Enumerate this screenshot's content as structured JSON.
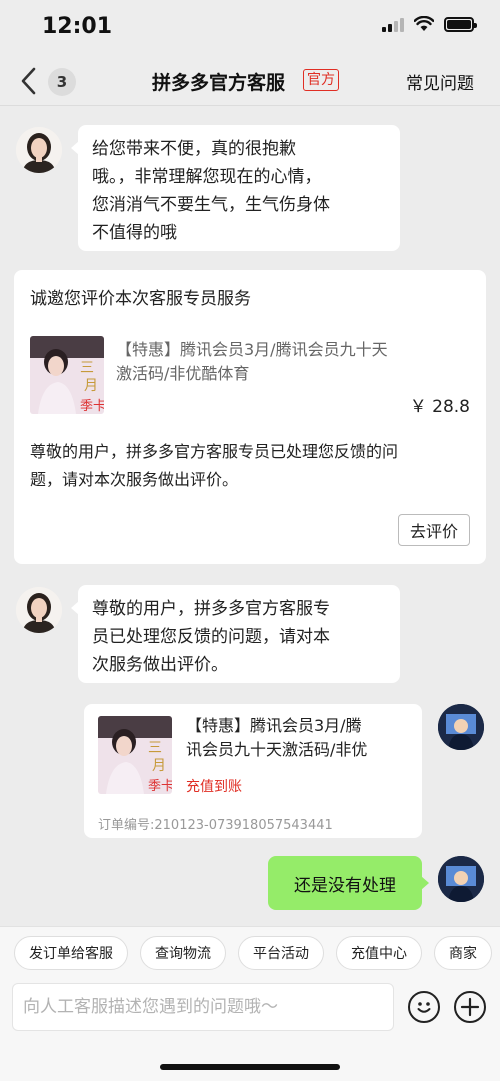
{
  "status_bar": {
    "time": "12:01"
  },
  "nav": {
    "back_icon": "chevron-left-icon",
    "unread_count": "3",
    "title": "拼多多官方客服",
    "official_tag": "官方",
    "faq_link": "常见问题"
  },
  "messages": {
    "agent_1": {
      "lines": [
        "给您带来不便，真的很抱歉",
        "哦。，非常理解您现在的心情，",
        "您消消气不要生气，生气伤身体",
        "不值得的哦"
      ]
    },
    "evaluation_card": {
      "title": "诚邀您评价本次客服专员服务",
      "product_title_lines": [
        "【特惠】腾讯会员3月/腾讯会员九十天",
        "激活码/非优酷体育"
      ],
      "price": "￥ 28.8",
      "body_lines": [
        "尊敬的用户，拼多多官方客服专员已处理您反馈的问",
        "题，请对本次服务做出评价。"
      ],
      "button": "去评价"
    },
    "agent_2": {
      "lines": [
        "尊敬的用户，拼多多官方客服专",
        "员已处理您反馈的问题，请对本",
        "次服务做出评价。"
      ]
    },
    "order_card": {
      "title_lines": [
        "【特惠】腾讯会员3月/腾",
        "讯会员九十天激活码/非优"
      ],
      "status": "充值到账",
      "order_no": "订单编号:210123-073918057543441"
    },
    "user_msg": "还是没有处理"
  },
  "quick_replies": [
    "发订单给客服",
    "查询物流",
    "平台活动",
    "充值中心",
    "商家"
  ],
  "composer": {
    "placeholder": "向人工客服描述您遇到的问题哦～",
    "emoji_icon": "smiley-icon",
    "plus_icon": "plus-icon"
  },
  "colors": {
    "brand_red": "#e02e24",
    "user_bubble": "#95ec69",
    "background": "#ececec"
  }
}
